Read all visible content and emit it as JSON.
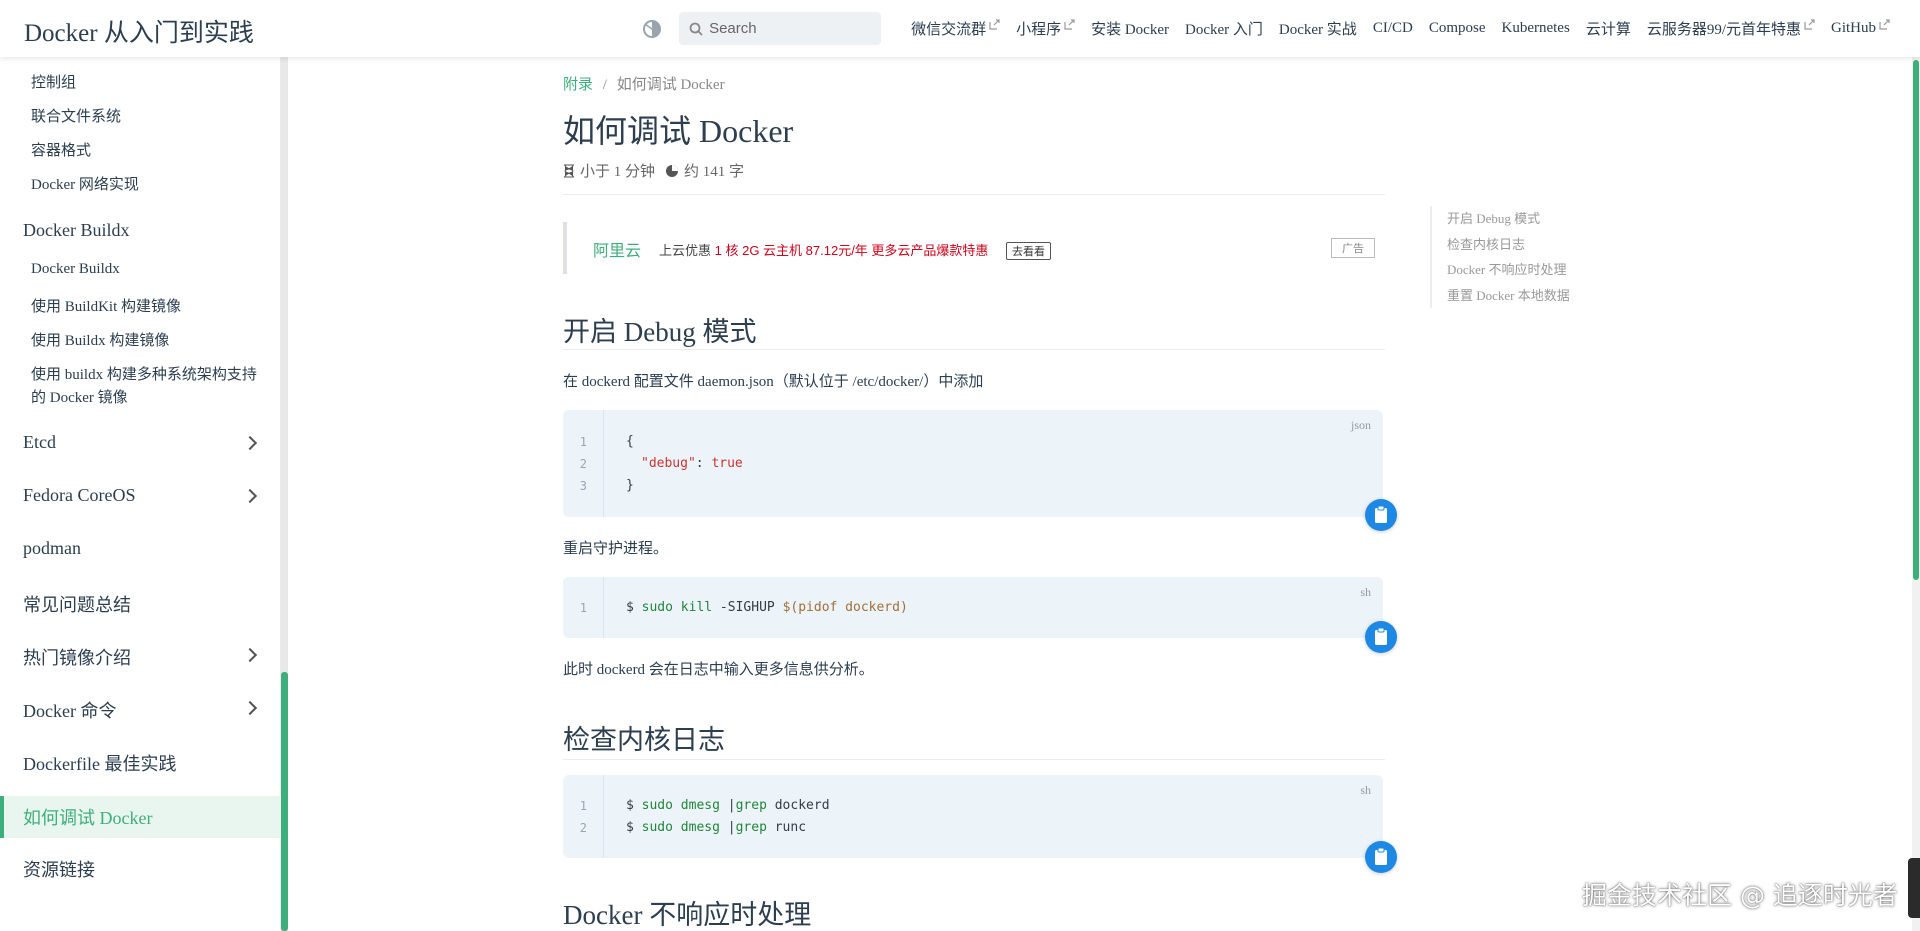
{
  "site_title": "Docker 从入门到实践",
  "search": {
    "placeholder": "Search"
  },
  "nav": [
    {
      "label": "微信交流群",
      "external": true
    },
    {
      "label": "小程序",
      "external": true
    },
    {
      "label": "安装 Docker",
      "external": false
    },
    {
      "label": "Docker 入门",
      "external": false
    },
    {
      "label": "Docker 实战",
      "external": false
    },
    {
      "label": "CI/CD",
      "external": false
    },
    {
      "label": "Compose",
      "external": false
    },
    {
      "label": "Kubernetes",
      "external": false
    },
    {
      "label": "云计算",
      "external": false
    },
    {
      "label": "云服务器99/元首年特惠",
      "external": true
    },
    {
      "label": "GitHub",
      "external": true
    }
  ],
  "sidebar": {
    "sub_top": [
      "控制组",
      "联合文件系统",
      "容器格式",
      "Docker 网络实现"
    ],
    "buildx_group": "Docker Buildx",
    "buildx_items": [
      "Docker Buildx",
      "使用 BuildKit 构建镜像",
      "使用 Buildx 构建镜像",
      "使用 buildx 构建多种系统架构支持",
      "的 Docker 镜像"
    ],
    "groups": [
      "Etcd",
      "Fedora CoreOS",
      "podman",
      "常见问题总结",
      "热门镜像介绍",
      "Docker 命令",
      "Dockerfile 最佳实践"
    ],
    "active": "如何调试 Docker",
    "last": "资源链接"
  },
  "breadcrumb": {
    "parent": "附录",
    "sep": "/",
    "current": "如何调试 Docker"
  },
  "title": "如何调试 Docker",
  "meta": {
    "read_time": "小于 1 分钟",
    "words": "约 141 字"
  },
  "ad": {
    "brand": "阿里云",
    "prefix": "上云优惠",
    "highlight": "1 核 2G 云主机 87.12元/年 更多云产品爆款特惠",
    "button": "去看看",
    "tag": "广告"
  },
  "sections": {
    "debug_heading": "开启 Debug 模式",
    "debug_intro": "在 dockerd 配置文件 daemon.json（默认位于 /etc/docker/）中添加",
    "restart_text": "重启守护进程。",
    "after_text": "此时 dockerd 会在日志中输入更多信息供分析。",
    "kernel_heading": "检查内核日志",
    "noresp_heading": "Docker 不响应时处理"
  },
  "code1": {
    "lang": "json",
    "l1": "{",
    "l2_key": "\"debug\"",
    "l2_sep": ": ",
    "l2_val": "true",
    "l3": "}"
  },
  "code2": {
    "lang": "sh",
    "prompt": "$ ",
    "cmd": "sudo kill",
    "args": " -SIGHUP ",
    "sub": "$(pidof dockerd)"
  },
  "code3": {
    "lang": "sh",
    "prompt": "$ ",
    "cmd": "sudo dmesg",
    "pipe": " |",
    "grep": "grep",
    "arg1": " dockerd",
    "arg2": " runc"
  },
  "toc": [
    "开启 Debug 模式",
    "检查内核日志",
    "Docker 不响应时处理",
    "重置 Docker 本地数据"
  ],
  "watermark": "掘金技术社区 @ 追逐时光者",
  "colors": {
    "accent": "#3eaf7c",
    "code_bg": "#ecf4fa",
    "copy_button": "#1e88e5",
    "ad_red": "#d0021b"
  }
}
